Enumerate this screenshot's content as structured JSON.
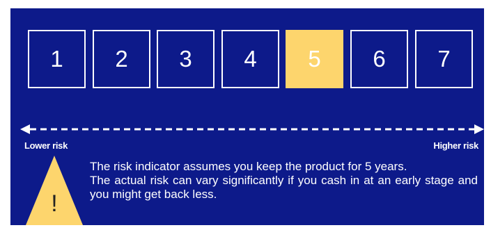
{
  "risk_scale": {
    "levels": [
      "1",
      "2",
      "3",
      "4",
      "5",
      "6",
      "7"
    ],
    "selected_level": 5
  },
  "labels": {
    "lower": "Lower risk",
    "higher": "Higher risk"
  },
  "warning": {
    "symbol": "!",
    "line1": "The risk indicator assumes you keep the product for 5 years.",
    "line2": "The actual risk can vary significantly if you cash in at an early stage and you might get back less."
  },
  "colors": {
    "background": "#0d1a8a",
    "highlight": "#fdd56d",
    "foreground": "#ffffff"
  },
  "icons": [
    "warning-triangle-icon",
    "double-arrow-icon"
  ]
}
